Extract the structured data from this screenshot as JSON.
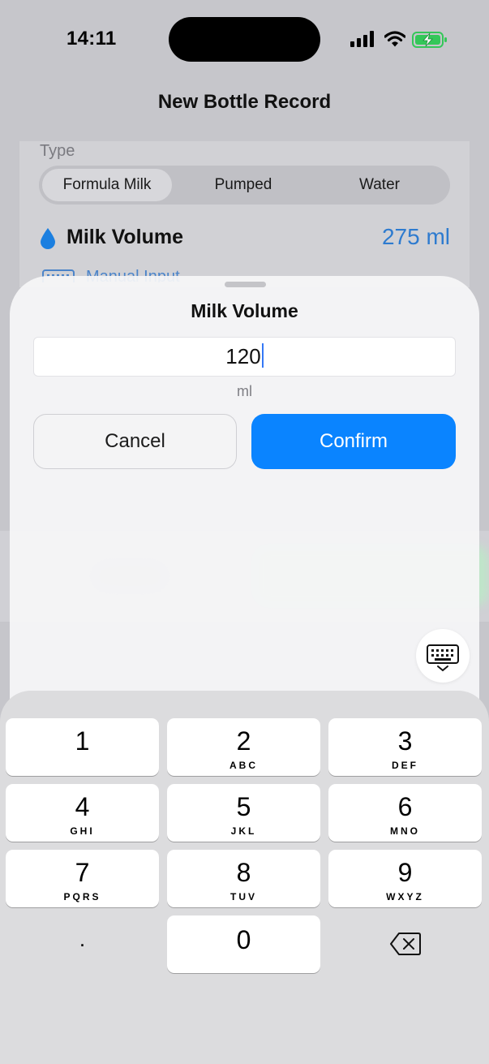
{
  "status_bar": {
    "time": "14:11"
  },
  "navigation": {
    "title": "New Bottle Record"
  },
  "form": {
    "type_label": "Type",
    "type_options": [
      "Formula Milk",
      "Pumped",
      "Water"
    ],
    "selected_type": "Formula Milk",
    "volume_label": "Milk Volume",
    "volume_value": "275 ml",
    "manual_input_label": "Manual Input"
  },
  "sheet": {
    "title": "Milk Volume",
    "input_value": "120",
    "unit": "ml",
    "cancel_label": "Cancel",
    "confirm_label": "Confirm"
  },
  "keypad": {
    "keys": [
      {
        "digit": "1",
        "letters": ""
      },
      {
        "digit": "2",
        "letters": "ABC"
      },
      {
        "digit": "3",
        "letters": "DEF"
      },
      {
        "digit": "4",
        "letters": "GHI"
      },
      {
        "digit": "5",
        "letters": "JKL"
      },
      {
        "digit": "6",
        "letters": "MNO"
      },
      {
        "digit": "7",
        "letters": "PQRS"
      },
      {
        "digit": "8",
        "letters": "TUV"
      },
      {
        "digit": "9",
        "letters": "WXYZ"
      },
      {
        "digit": "0",
        "letters": ""
      }
    ],
    "decimal": "."
  },
  "colors": {
    "accent": "#0a84ff",
    "volume_value": "#2e7bcf",
    "battery_charging": "#34c759"
  },
  "icons": [
    "water-drop-icon",
    "keyboard-icon",
    "delete-backspace-icon",
    "cellular-signal-icon",
    "wifi-icon",
    "battery-charging-icon"
  ]
}
